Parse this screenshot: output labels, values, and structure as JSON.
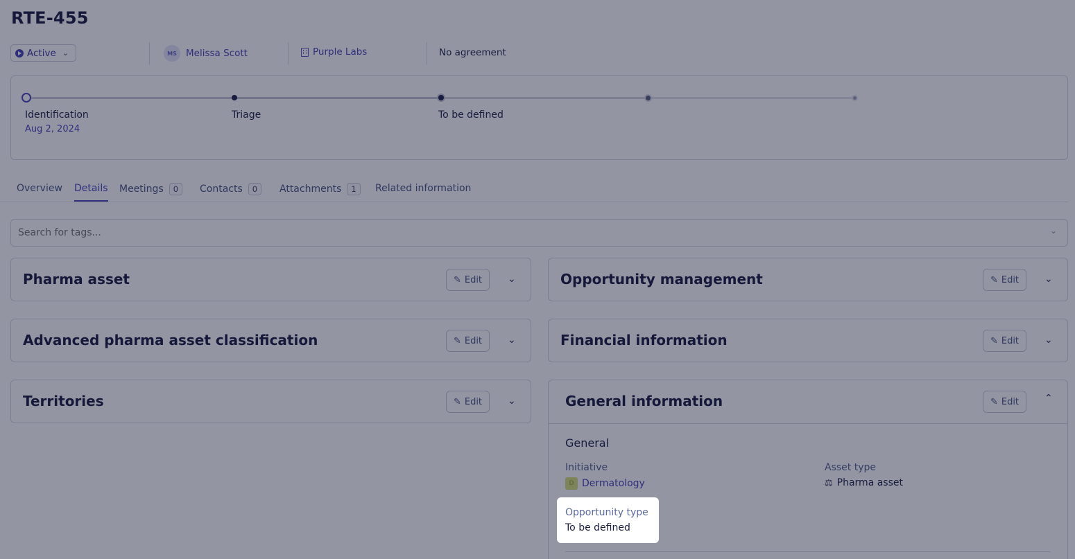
{
  "header": {
    "title": "RTE-455",
    "status": "Active",
    "owner_initials": "MS",
    "owner_name": "Melissa Scott",
    "company": "Purple Labs",
    "agreement": "No agreement"
  },
  "stages": {
    "items": [
      {
        "label": "Identification",
        "date": "Aug 2, 2024"
      },
      {
        "label": "Triage",
        "date": ""
      },
      {
        "label": "To be defined",
        "date": ""
      },
      {
        "label": "",
        "date": ""
      },
      {
        "label": "",
        "date": ""
      }
    ],
    "current_index": 0
  },
  "tabs": [
    {
      "label": "Overview",
      "count": null
    },
    {
      "label": "Details",
      "count": null
    },
    {
      "label": "Meetings",
      "count": "0"
    },
    {
      "label": "Contacts",
      "count": "0"
    },
    {
      "label": "Attachments",
      "count": "1"
    },
    {
      "label": "Related information",
      "count": null
    }
  ],
  "active_tab": "Details",
  "tag_search": {
    "placeholder": "Search for tags..."
  },
  "edit_label": "Edit",
  "sections_left": [
    {
      "title": "Pharma asset"
    },
    {
      "title": "Advanced pharma asset classification"
    },
    {
      "title": "Territories"
    }
  ],
  "sections_right": [
    {
      "title": "Opportunity management"
    },
    {
      "title": "Financial information"
    },
    {
      "title": "General information"
    }
  ],
  "general_information": {
    "subheading": "General",
    "initiative_label": "Initiative",
    "initiative_badge": "D",
    "initiative_value": "Dermatology",
    "asset_type_label": "Asset type",
    "asset_type_value": "Pharma asset",
    "opportunity_type_label": "Opportunity type",
    "opportunity_type_value": "To be defined"
  },
  "colors": {
    "accent": "#4b45b8",
    "text": "#1f2347",
    "overlay": "#0f1532"
  }
}
